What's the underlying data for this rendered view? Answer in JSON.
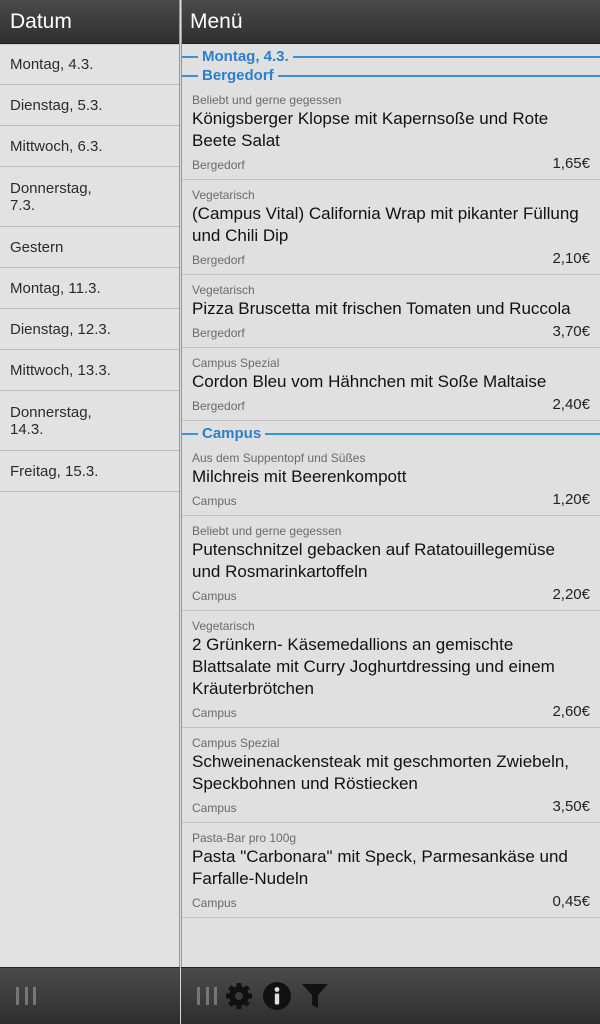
{
  "left": {
    "title": "Datum",
    "dates": [
      {
        "label": "Montag, 4.3.",
        "tall": false
      },
      {
        "label": "Dienstag, 5.3.",
        "tall": false
      },
      {
        "label": "Mittwoch, 6.3.",
        "tall": false
      },
      {
        "label": "Donnerstag,\n7.3.",
        "tall": true
      },
      {
        "label": "Gestern",
        "tall": false
      },
      {
        "label": "Montag, 11.3.",
        "tall": false
      },
      {
        "label": "Dienstag, 12.3.",
        "tall": false
      },
      {
        "label": "Mittwoch, 13.3.",
        "tall": false
      },
      {
        "label": "Donnerstag,\n14.3.",
        "tall": true
      },
      {
        "label": "Freitag, 15.3.",
        "tall": false
      }
    ]
  },
  "right": {
    "title": "Menü",
    "day_header": "Montag, 4.3.",
    "sections": [
      {
        "title": "Bergedorf",
        "items": [
          {
            "category": "Beliebt und gerne gegessen",
            "name": "Königsberger Klopse mit Kapernsoße und Rote Beete Salat",
            "location": "Bergedorf",
            "price": "1,65€"
          },
          {
            "category": "Vegetarisch",
            "name": "(Campus Vital) California Wrap mit pikanter Füllung und Chili Dip",
            "location": "Bergedorf",
            "price": "2,10€"
          },
          {
            "category": "Vegetarisch",
            "name": "Pizza Bruscetta mit frischen Tomaten und Ruccola",
            "location": "Bergedorf",
            "price": "3,70€"
          },
          {
            "category": "Campus Spezial",
            "name": "Cordon Bleu vom Hähnchen mit Soße Maltaise",
            "location": "Bergedorf",
            "price": "2,40€"
          }
        ]
      },
      {
        "title": "Campus",
        "items": [
          {
            "category": "Aus dem Suppentopf und Süßes",
            "name": "Milchreis mit Beerenkompott",
            "location": "Campus",
            "price": "1,20€"
          },
          {
            "category": "Beliebt und gerne gegessen",
            "name": "Putenschnitzel gebacken auf Ratatouillegemüse und Rosmarinkartoffeln",
            "location": "Campus",
            "price": "2,20€"
          },
          {
            "category": "Vegetarisch",
            "name": "2 Grünkern- Käsemedallions an gemischte Blattsalate mit Curry Joghurtdressing und einem Kräuterbrötchen",
            "location": "Campus",
            "price": "2,60€"
          },
          {
            "category": "Campus Spezial",
            "name": "Schweinenackensteak mit geschmorten Zwiebeln, Speckbohnen und Röstiecken",
            "location": "Campus",
            "price": "3,50€"
          },
          {
            "category": "Pasta-Bar pro 100g",
            "name": "Pasta \"Carbonara\" mit Speck, Parmesankäse und Farfalle-Nudeln",
            "location": "Campus",
            "price": "0,45€"
          }
        ]
      }
    ]
  },
  "toolbar": {
    "icons": [
      "gear-icon",
      "info-icon",
      "filter-icon"
    ]
  },
  "colors": {
    "accent": "#2a7fcf",
    "header_bg": "#3a3a3a",
    "pane_bg": "#e0e0e0"
  }
}
